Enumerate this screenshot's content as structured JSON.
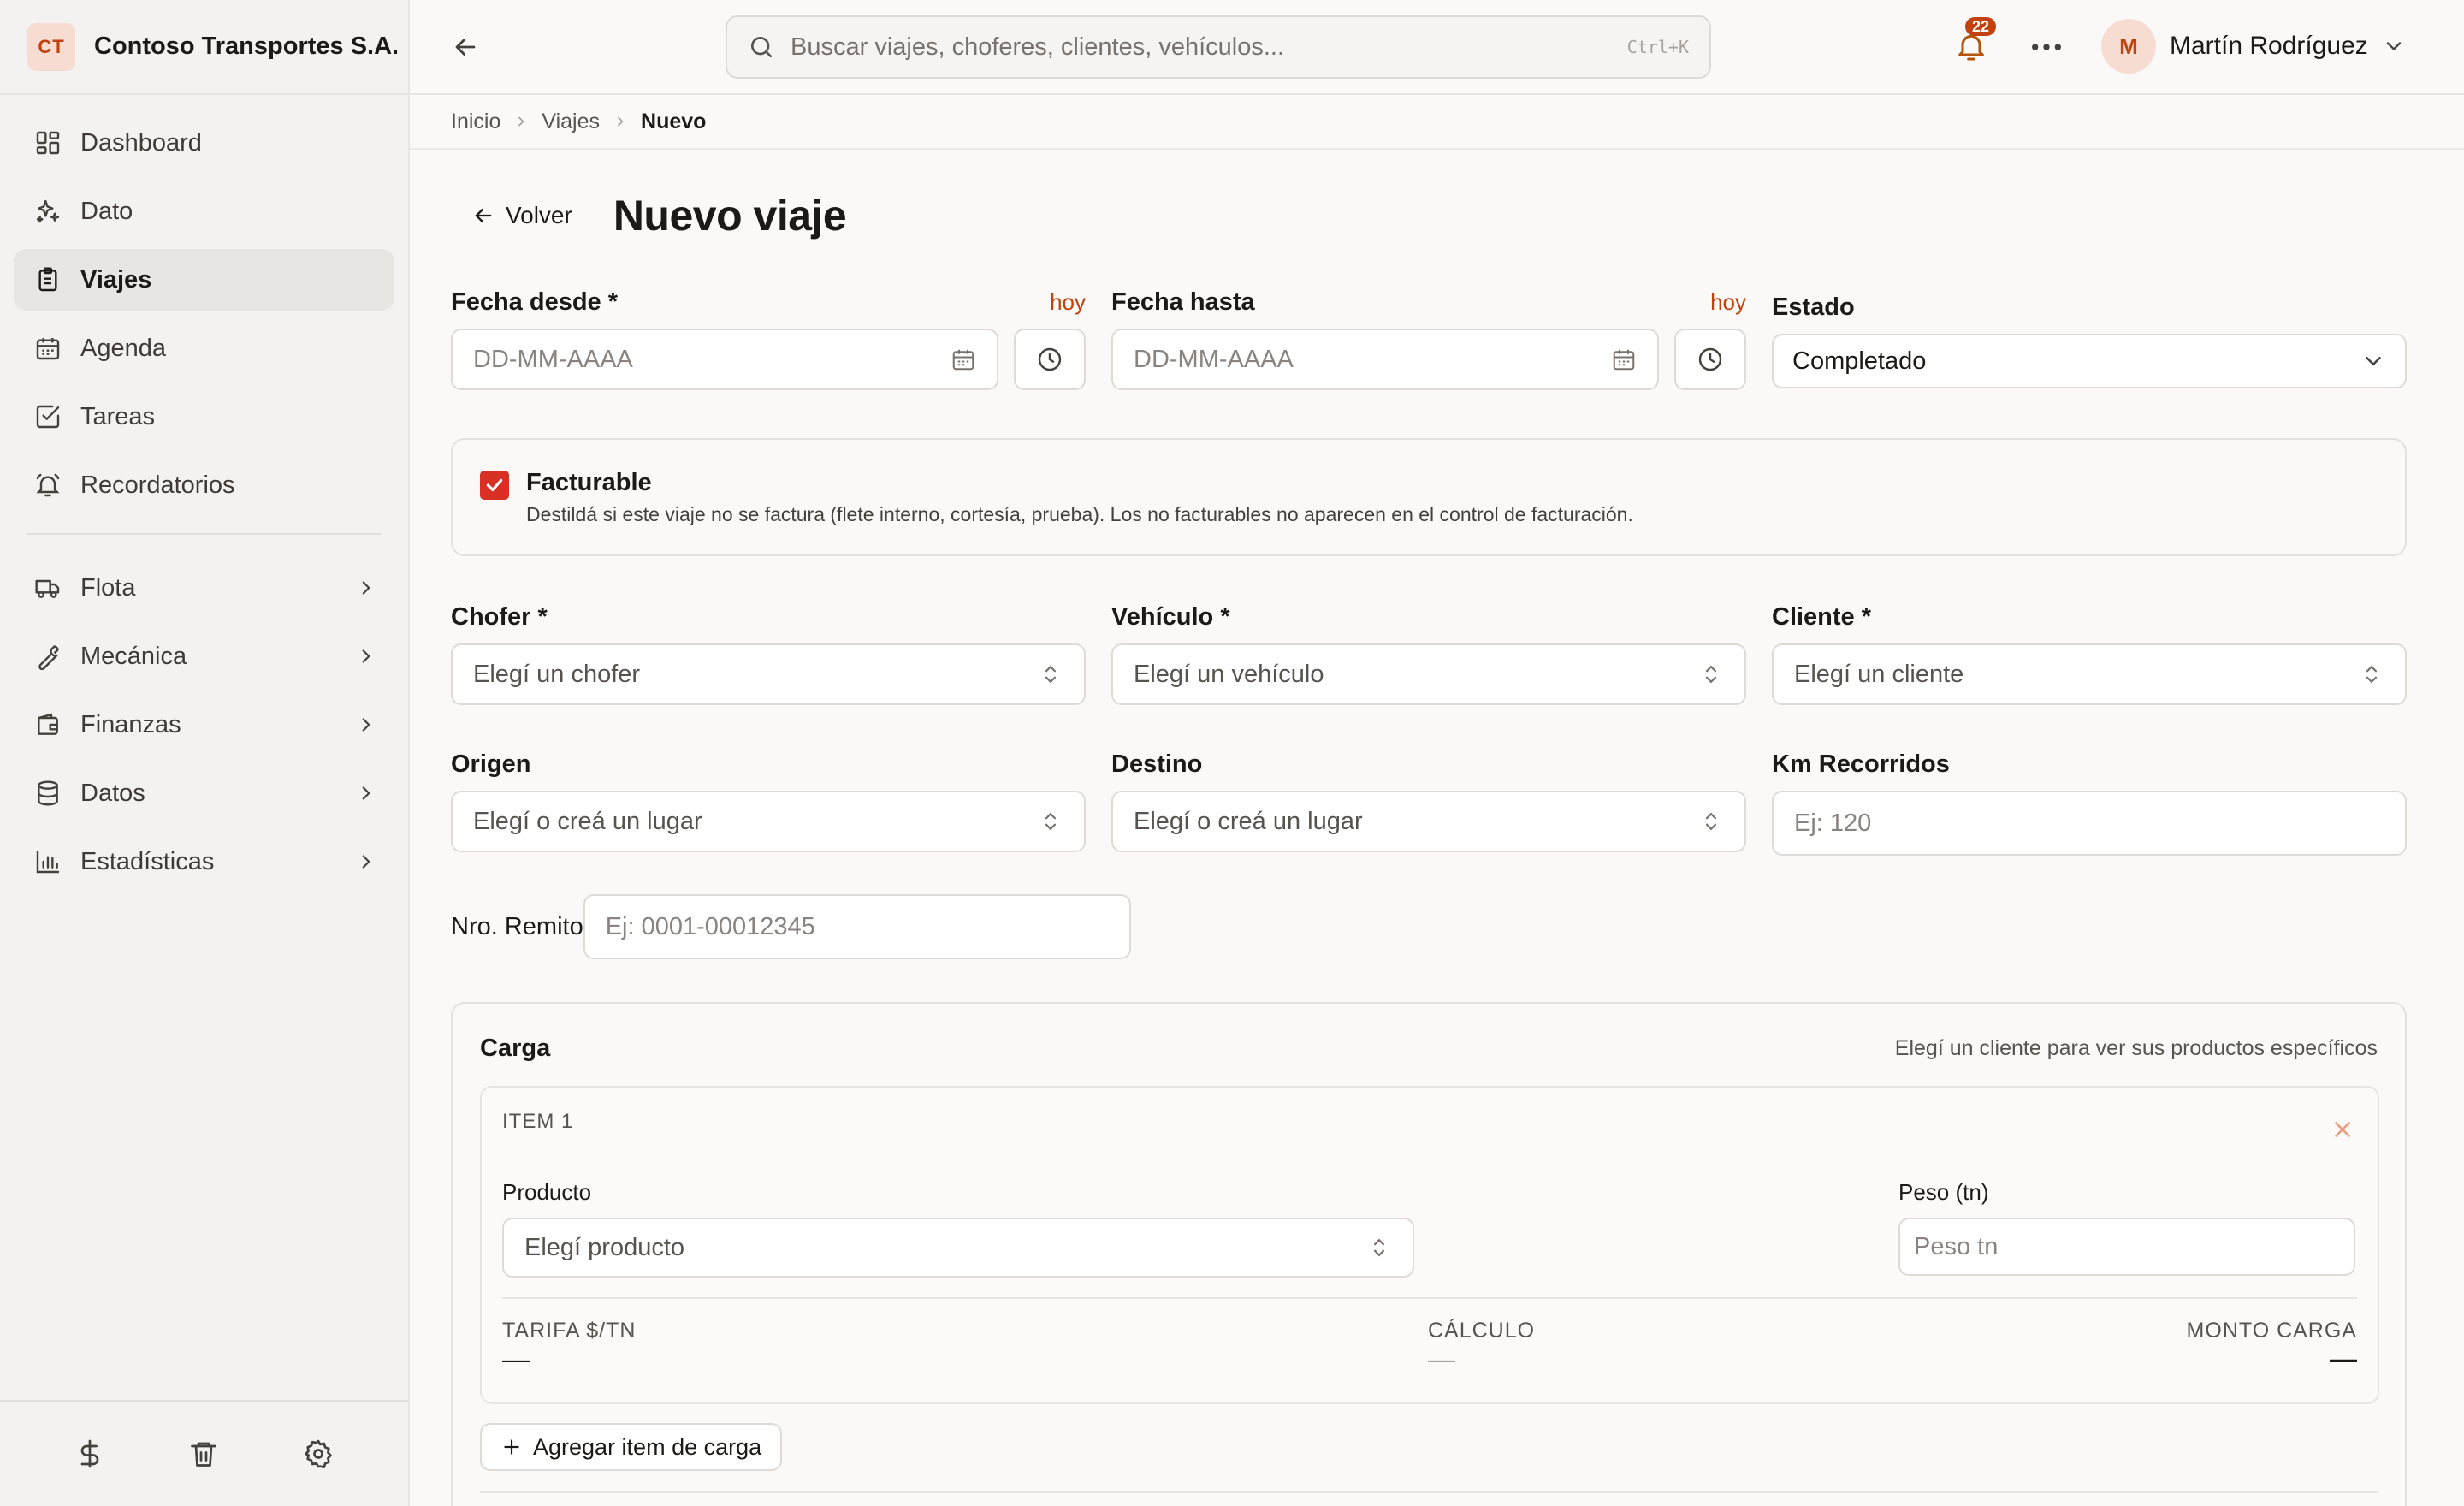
{
  "brand": {
    "initials": "CT",
    "name": "Contoso Transportes S.A."
  },
  "sidebar": {
    "items": [
      {
        "label": "Dashboard",
        "icon": "dashboard-icon"
      },
      {
        "label": "Dato",
        "icon": "sparkles-icon"
      },
      {
        "label": "Viajes",
        "icon": "clipboard-icon",
        "active": true
      },
      {
        "label": "Agenda",
        "icon": "calendar-icon"
      },
      {
        "label": "Tareas",
        "icon": "check-square-icon"
      },
      {
        "label": "Recordatorios",
        "icon": "bell-ring-icon"
      },
      {
        "label": "Flota",
        "icon": "truck-icon",
        "expandable": true
      },
      {
        "label": "Mecánica",
        "icon": "wrench-icon",
        "expandable": true
      },
      {
        "label": "Finanzas",
        "icon": "wallet-icon",
        "expandable": true
      },
      {
        "label": "Datos",
        "icon": "database-icon",
        "expandable": true
      },
      {
        "label": "Estadísticas",
        "icon": "bar-chart-icon",
        "expandable": true
      }
    ],
    "footer": [
      "dollar-icon",
      "trash-icon",
      "gear-icon"
    ]
  },
  "topbar": {
    "search_placeholder": "Buscar viajes, choferes, clientes, vehículos...",
    "shortcut": "Ctrl+K",
    "notifications": "22",
    "user_initial": "M",
    "user_name": "Martín Rodríguez"
  },
  "breadcrumb": {
    "items": [
      "Inicio",
      "Viajes"
    ],
    "current": "Nuevo"
  },
  "page": {
    "back_label": "Volver",
    "title": "Nuevo viaje"
  },
  "form": {
    "fecha_desde": {
      "label": "Fecha desde *",
      "placeholder": "DD-MM-AAAA",
      "today": "hoy"
    },
    "fecha_hasta": {
      "label": "Fecha hasta",
      "placeholder": "DD-MM-AAAA",
      "today": "hoy"
    },
    "estado": {
      "label": "Estado",
      "value": "Completado"
    },
    "facturable": {
      "label": "Facturable",
      "checked": true,
      "description": "Destildá si este viaje no se factura (flete interno, cortesía, prueba). Los no facturables no aparecen en el control de facturación."
    },
    "chofer": {
      "label": "Chofer *",
      "placeholder": "Elegí un chofer"
    },
    "vehiculo": {
      "label": "Vehículo *",
      "placeholder": "Elegí un vehículo"
    },
    "cliente": {
      "label": "Cliente *",
      "placeholder": "Elegí un cliente"
    },
    "origen": {
      "label": "Origen",
      "placeholder": "Elegí o creá un lugar"
    },
    "destino": {
      "label": "Destino",
      "placeholder": "Elegí o creá un lugar"
    },
    "km": {
      "label": "Km Recorridos",
      "placeholder": "Ej: 120"
    },
    "remito": {
      "label": "Nro. Remito",
      "placeholder": "Ej: 0001-00012345"
    }
  },
  "carga": {
    "title": "Carga",
    "hint": "Elegí un cliente para ver sus productos específicos",
    "item": {
      "tag": "ITEM 1",
      "producto_label": "Producto",
      "producto_placeholder": "Elegí producto",
      "peso_label": "Peso (tn)",
      "peso_placeholder": "Peso tn",
      "tarifa_label": "TARIFA $/TN",
      "tarifa_value": "—",
      "calculo_label": "CÁLCULO",
      "calculo_value": "—",
      "monto_label": "MONTO CARGA",
      "monto_value": "—"
    },
    "add_label": "Agregar item de carga"
  },
  "colors": {
    "accent": "#c2410c",
    "checkbox": "#d93025",
    "sidebar_bg": "#f3f2f0",
    "page_bg": "#faf9f7"
  }
}
